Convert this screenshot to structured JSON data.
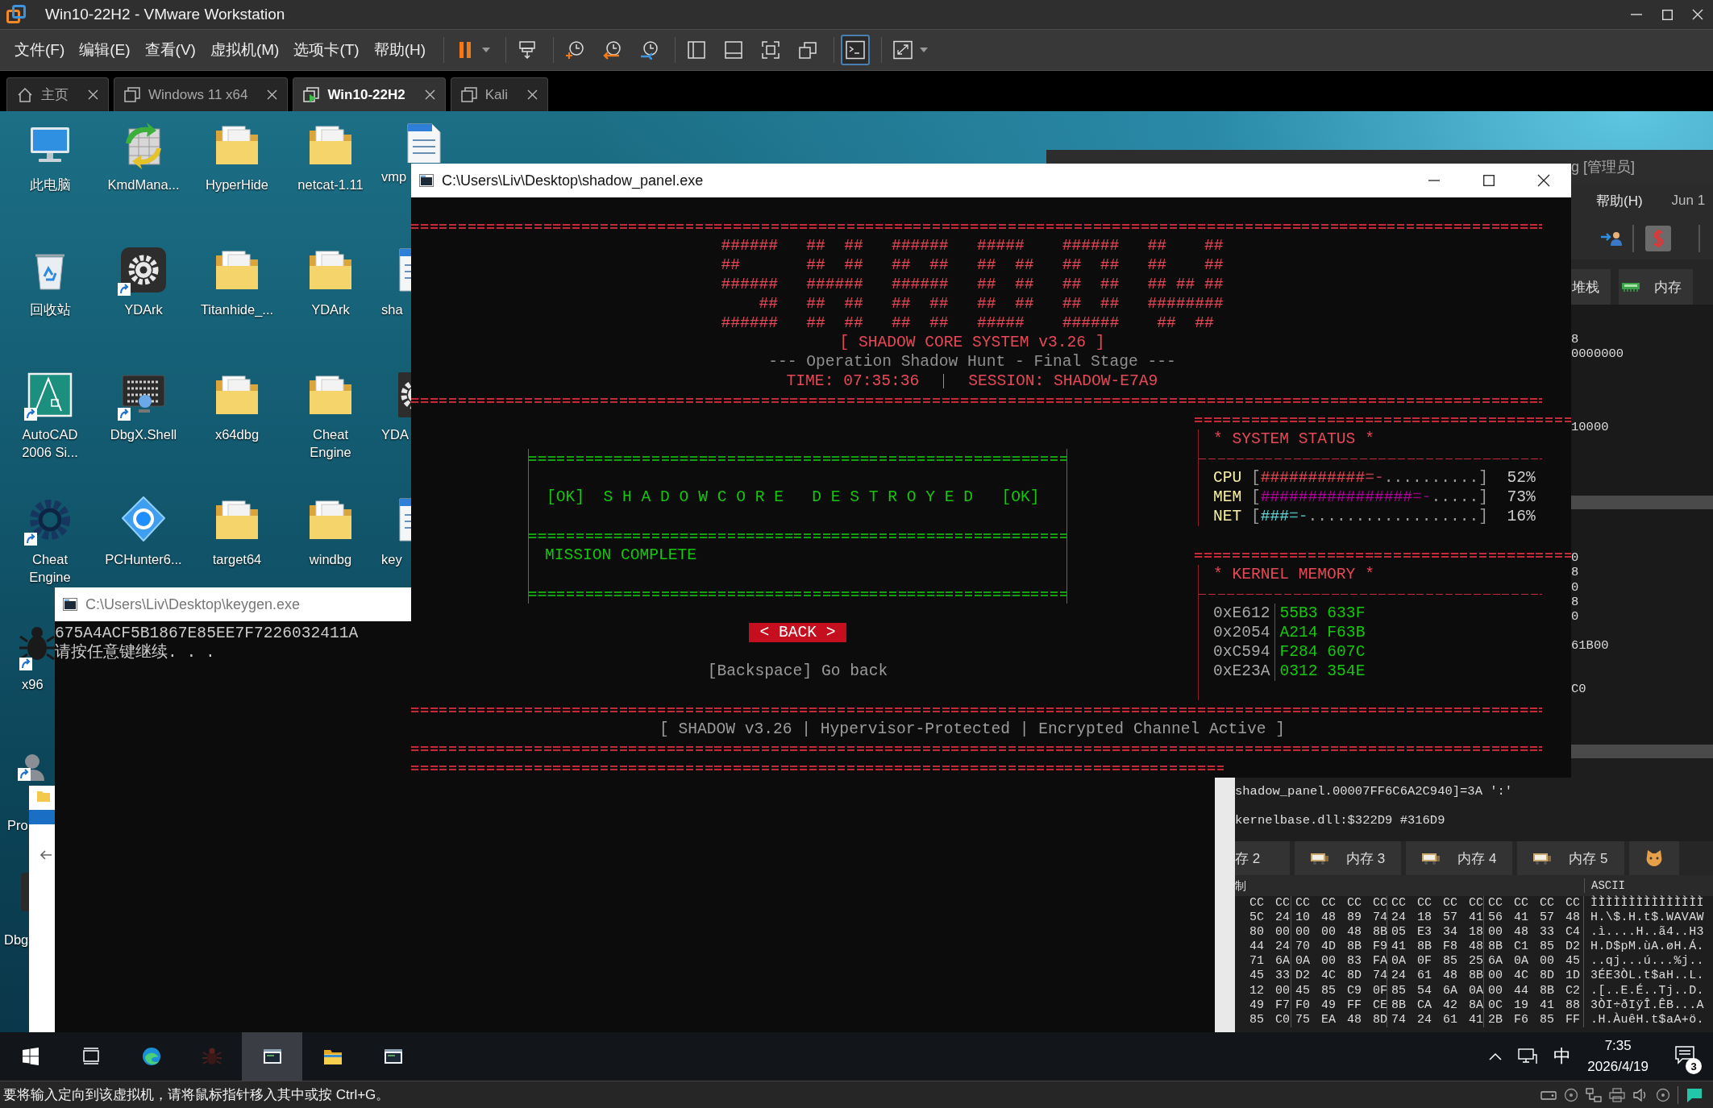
{
  "window": {
    "title": "Win10-22H2 - VMware Workstation"
  },
  "menu": [
    "文件(F)",
    "编辑(E)",
    "查看(V)",
    "虚拟机(M)",
    "选项卡(T)",
    "帮助(H)"
  ],
  "toolbar": [
    [
      {
        "kind": "pause",
        "on": false,
        "dropdown": true
      }
    ],
    [
      {
        "kind": "send-keys",
        "on": false,
        "dropdown": false
      }
    ],
    [
      {
        "kind": "snapshot-take",
        "on": false,
        "dropdown": false
      },
      {
        "kind": "snapshot-revert",
        "on": false,
        "dropdown": false
      },
      {
        "kind": "snapshot-manager",
        "on": false,
        "dropdown": false
      }
    ],
    [
      {
        "kind": "library",
        "on": false,
        "dropdown": false
      },
      {
        "kind": "thumbnail-bar",
        "on": false,
        "dropdown": false
      },
      {
        "kind": "full-screen",
        "on": false,
        "dropdown": false
      },
      {
        "kind": "unity",
        "on": false,
        "dropdown": false
      }
    ],
    [
      {
        "kind": "console",
        "on": true,
        "dropdown": false
      }
    ],
    [
      {
        "kind": "stretch",
        "on": false,
        "dropdown": true
      }
    ]
  ],
  "tabs": [
    {
      "label": "主页",
      "kind": "home",
      "selected": false
    },
    {
      "label": "Windows 11 x64",
      "kind": "vm",
      "selected": false
    },
    {
      "label": "Win10-22H2",
      "kind": "vm-running",
      "selected": true
    },
    {
      "label": "Kali",
      "kind": "vm",
      "selected": false
    }
  ],
  "desktop": {
    "columns": [
      [
        {
          "label": "此电脑",
          "kind": "pc",
          "shortcut": false
        },
        {
          "label": "回收站",
          "kind": "recycle",
          "shortcut": false
        },
        {
          "label": "AutoCAD 2006 Si...",
          "kind": "cad",
          "shortcut": true
        },
        {
          "label": "Cheat Engine",
          "kind": "cheat-engine",
          "shortcut": true
        },
        {
          "label": "x96",
          "kind": "bug",
          "shortcut": true
        },
        {
          "label": "Pro",
          "kind": "person",
          "shortcut": true
        },
        {
          "label": "Dbg",
          "kind": "dark-app",
          "shortcut": false
        }
      ],
      [
        {
          "label": "KmdMana...",
          "kind": "arrows",
          "shortcut": false
        },
        {
          "label": "YDArk",
          "kind": "gear-eye",
          "shortcut": true
        },
        {
          "label": "DbgX.Shell",
          "kind": "binary-screen",
          "shortcut": true
        },
        {
          "label": "PCHunter6...",
          "kind": "hunter",
          "shortcut": false
        }
      ],
      [
        {
          "label": "HyperHide",
          "kind": "folder",
          "shortcut": false
        },
        {
          "label": "Titanhide_...",
          "kind": "folder",
          "shortcut": false
        },
        {
          "label": "x64dbg",
          "kind": "folder",
          "shortcut": false
        },
        {
          "label": "target64",
          "kind": "folder",
          "shortcut": false
        }
      ],
      [
        {
          "label": "netcat-1.11",
          "kind": "folder",
          "shortcut": false
        },
        {
          "label": "YDArk",
          "kind": "folder",
          "shortcut": false
        },
        {
          "label": "Cheat Engine",
          "kind": "folder",
          "shortcut": false
        },
        {
          "label": "windbg",
          "kind": "folder",
          "shortcut": false
        }
      ],
      [
        {
          "label": "vmp",
          "kind": "document",
          "shortcut": false
        },
        {
          "label": "sha",
          "kind": "document",
          "shortcut": false
        },
        {
          "label": "YDA",
          "kind": "gear-eye",
          "shortcut": false
        },
        {
          "label": "key",
          "kind": "document",
          "shortcut": false
        }
      ]
    ]
  },
  "keygen": {
    "title": "C:\\Users\\Liv\\Desktop\\keygen.exe",
    "lines": [
      "675A4ACF5B1867E85EE7F7226032411A",
      "请按任意键继续. . ."
    ]
  },
  "shadow_panel": {
    "title": "C:\\Users\\Liv\\Desktop\\shadow_panel.exe",
    "banner": [
      "######   ##  ##   ######   #####    ######   ##    ##",
      "##       ##  ##   ##  ##   ##  ##   ##  ##   ##    ##",
      "######   ######   ######   ##  ##   ##  ##   ## ## ##",
      "    ##   ##  ##   ##  ##   ##  ##   ##  ##   ########",
      "######   ##  ##   ##  ##   #####    ######    ##  ##"
    ],
    "heading": "[ SHADOW CORE SYSTEM v3.26 ]",
    "subtitle": "--- Operation Shadow Hunt - Final Stage ---",
    "time": "TIME: 07:35:36",
    "session": "SESSION: SHADOW-E7A9",
    "result": {
      "status": "[OK]  S H A D O W C O R E   D E S T R O Y E D   [OK]",
      "message": "MISSION COMPLETE"
    },
    "back_button": "< BACK >",
    "hint": "[Backspace] Go back",
    "system_status": {
      "title": "* SYSTEM STATUS *",
      "meters": [
        {
          "name": "CPU",
          "open": "[",
          "fill": "###########",
          "edge": "=-",
          "rest": "..........",
          "close": "]",
          "reading": "52%",
          "color": "#e74856"
        },
        {
          "name": "MEM",
          "open": "[",
          "fill": "################",
          "edge": "=-",
          "rest": ".....",
          "close": "]",
          "reading": "73%",
          "color": "#b4009e"
        },
        {
          "name": "NET",
          "open": "[",
          "fill": "###",
          "edge": "=-",
          "rest": "..................",
          "close": "]",
          "reading": "16%",
          "color": "#61d6d6"
        }
      ]
    },
    "kernel_memory": {
      "title": "* KERNEL MEMORY *",
      "rows": [
        {
          "address": "0xE612",
          "value": "55B3 633F"
        },
        {
          "address": "0x2054",
          "value": "A214 F63B"
        },
        {
          "address": "0xC594",
          "value": "F284 607C"
        },
        {
          "address": "0xE23A",
          "value": "0312 354E"
        }
      ]
    },
    "footer": "[ SHADOW v3.26 | Hypervisor-Protected | Encrypted Channel Active ]"
  },
  "debugger": {
    "title": "g [管理员]",
    "menu": [
      "帮助(H)"
    ],
    "date": "Jun 1",
    "tabs": [
      {
        "label": "堆栈",
        "kind": "plain"
      },
      {
        "label": "内存",
        "kind": "memory"
      }
    ],
    "upper_blocks": [
      [
        "8",
        "0000000"
      ],
      [
        "10000"
      ]
    ],
    "lower_blocks": [
      [
        "0",
        "8",
        "0",
        "8",
        "0"
      ],
      [
        "61B00"
      ],
      [
        "C0"
      ]
    ],
    "log": [
      "shadow_panel.00007FF6C6A2C940]=3A ':'",
      "kernelbase.dll:$322D9 #316D9"
    ],
    "dump_tabs": [
      {
        "label": "存 2",
        "kind": "plain"
      },
      {
        "label": "内存 3",
        "kind": "memory"
      },
      {
        "label": "内存 4",
        "kind": "memory"
      },
      {
        "label": "内存 5",
        "kind": "memory"
      },
      {
        "kind": "cat"
      }
    ],
    "dump": {
      "hex_header": "制",
      "ascii_header": "ASCII",
      "rows": [
        {
          "hex": [
            "CC CC",
            "CC CC CC CC",
            "CC CC CC CC",
            "CC CC CC CC"
          ],
          "ascii": "ÌÌÌÌÌÌÌÌÌÌÌÌÌÌÌ"
        },
        {
          "hex": [
            "5C 24",
            "10 48 89 74",
            "24 18 57 41",
            "56 41 57 48"
          ],
          "ascii": "H.\\$.H.t$.WAVAW"
        },
        {
          "hex": [
            "80 00",
            "00 00 48 8B",
            "05 E3 34 18",
            "00 48 33 C4"
          ],
          "ascii": ".ì....H..ã4..H3"
        },
        {
          "hex": [
            "44 24",
            "70 4D 8B F9",
            "41 8B F8 48",
            "8B C1 85 D2"
          ],
          "ascii": "H.D$pM.ùA.øH.Á."
        },
        {
          "hex": [
            "71 6A",
            "0A 00 83 FA",
            "0A 0F 85 25",
            "6A 0A 00 45"
          ],
          "ascii": "..qj...ú...%j.."
        },
        {
          "hex": [
            "45 33",
            "D2 4C 8D 74",
            "24 61 48 8B",
            "00 4C 8D 1D"
          ],
          "ascii": "3ÉE3ÒL.t$aH..L."
        },
        {
          "hex": [
            "12 00",
            "45 85 C9 0F",
            "85 54 6A 0A",
            "00 44 8B C2"
          ],
          "ascii": ".[..E.É..Tj..D."
        },
        {
          "hex": [
            "49 F7",
            "F0 49 FF CE",
            "8B CA 42 8A",
            "0C 19 41 88"
          ],
          "ascii": "3ÒI÷ðIÿÎ.ÊB...A"
        },
        {
          "hex": [
            "85 C0",
            "75 EA 48 8D",
            "74 24 61 41",
            "2B F6 85 FF"
          ],
          "ascii": ".H.ÀuêH.t$aA+ö."
        }
      ]
    }
  },
  "taskbar": {
    "items": [
      {
        "kind": "start",
        "selected": false
      },
      {
        "kind": "task-view",
        "selected": false
      },
      {
        "kind": "browser",
        "selected": false
      },
      {
        "kind": "bug",
        "selected": false
      },
      {
        "kind": "console",
        "selected": true
      },
      {
        "kind": "folder",
        "selected": false
      },
      {
        "kind": "console",
        "selected": false
      }
    ],
    "ime": "中",
    "time": "7:35",
    "date": "2026/4/19",
    "notifications": "3"
  },
  "status_bar": {
    "message": "要将输入定向到该虚拟机，请将鼠标指针移入其中或按 Ctrl+G。"
  }
}
